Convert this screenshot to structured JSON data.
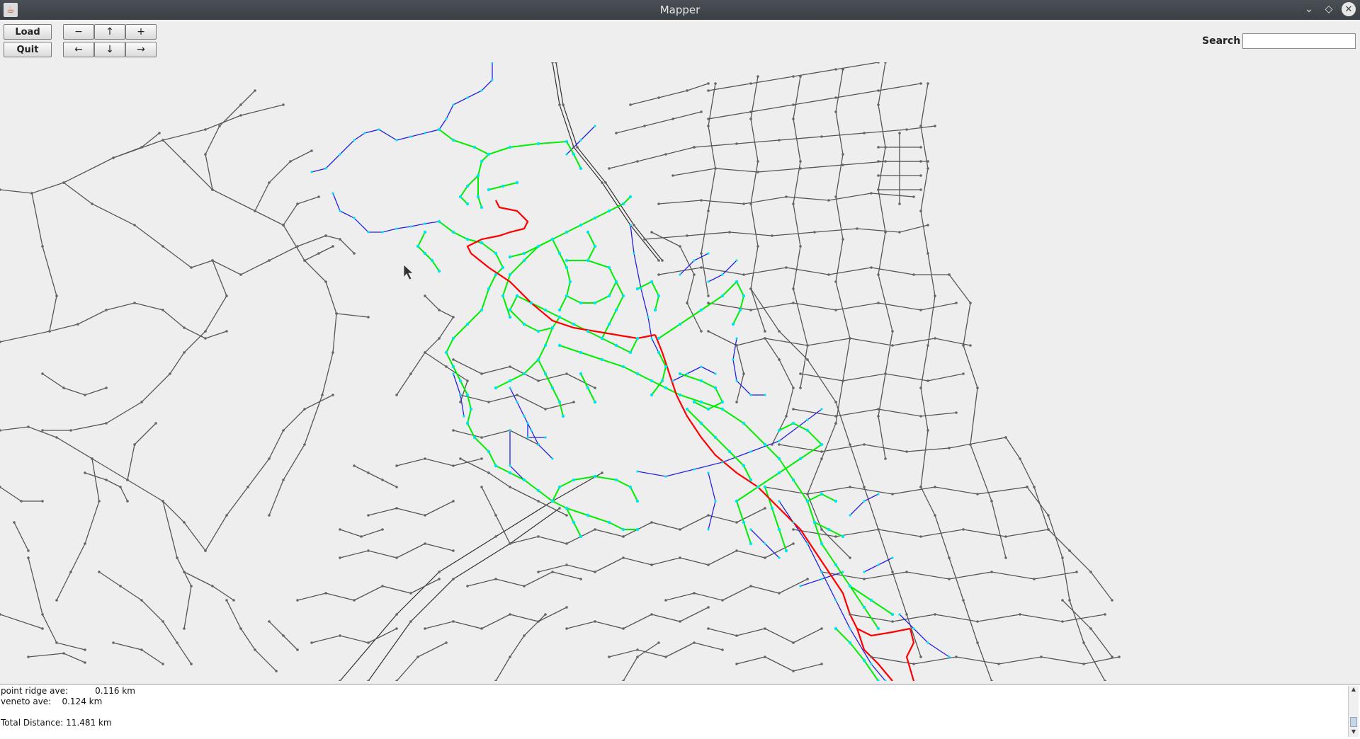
{
  "window": {
    "title": "Mapper",
    "app_icon": "java-cup-icon",
    "controls": [
      "minimize-icon",
      "maximize-icon",
      "close-icon"
    ]
  },
  "toolbar": {
    "load_label": "Load",
    "quit_label": "Quit",
    "zoom_out_label": "−",
    "up_label": "↑",
    "zoom_in_label": "+",
    "left_label": "←",
    "down_label": "↓",
    "right_label": "→"
  },
  "search": {
    "label": "Search",
    "value": ""
  },
  "map": {
    "colors": {
      "background": "#eeeeee",
      "road": "#555555",
      "node": "#666666",
      "route": "#ff0000",
      "highlight_road": "#00ee00",
      "highlight_node": "#00e5ee",
      "secondary_road": "#2222dd"
    }
  },
  "output": {
    "lines": [
      "point ridge ave:          0.116 km",
      "veneto ave:    0.124 km",
      "",
      "Total Distance: 11.481 km"
    ]
  }
}
